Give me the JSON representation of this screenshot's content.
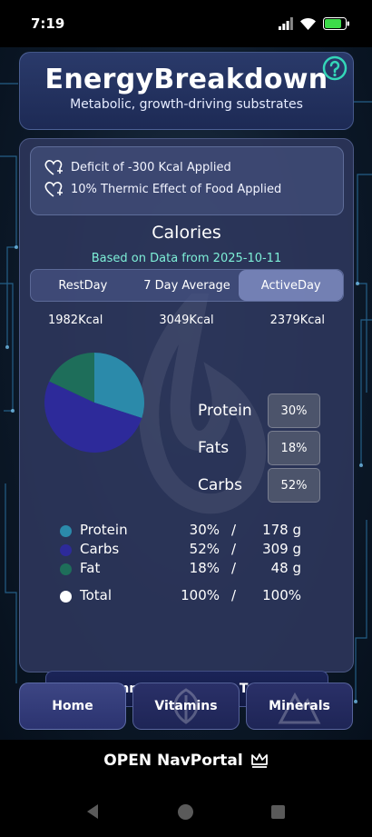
{
  "status": {
    "time": "7:19"
  },
  "header": {
    "title": "EnergyBreakdown",
    "subtitle": "Metabolic, growth-driving substrates",
    "help_icon": "help-circle-icon"
  },
  "notes": [
    {
      "icon": "heart-plus-icon",
      "text": "Deficit of -300 Kcal Applied"
    },
    {
      "icon": "heart-plus-icon",
      "text": "10% Thermic Effect of Food Applied"
    }
  ],
  "calories": {
    "title": "Calories",
    "data_date": "Based on Data from 2025-10-11",
    "tabs": [
      {
        "label": "RestDay",
        "active": false
      },
      {
        "label": "7 Day Average",
        "active": false
      },
      {
        "label": "ActiveDay",
        "active": true
      }
    ],
    "kcal_values": [
      "1982Kcal",
      "3049Kcal",
      "2379Kcal"
    ]
  },
  "macro_pills": [
    {
      "label": "Protein",
      "value": "30%"
    },
    {
      "label": "Fats",
      "value": "18%"
    },
    {
      "label": "Carbs",
      "value": "52%"
    }
  ],
  "chart_data": {
    "type": "pie",
    "slices": [
      {
        "name": "Protein",
        "value": 30,
        "color": "#2b8aaa"
      },
      {
        "name": "Carbs",
        "value": 52,
        "color": "#2d2a9a"
      },
      {
        "name": "Fat",
        "value": 18,
        "color": "#1e6e5a"
      }
    ]
  },
  "legend": [
    {
      "name": "Protein",
      "percent": "30%",
      "slash": "/",
      "grams": "178 g",
      "color": "#2b8aaa"
    },
    {
      "name": "Carbs",
      "percent": "52%",
      "slash": "/",
      "grams": "309 g",
      "color": "#2d2a9a"
    },
    {
      "name": "Fat",
      "percent": "18%",
      "slash": "/",
      "grams": "48 g",
      "color": "#1e6e5a"
    }
  ],
  "total": {
    "name": "Total",
    "percent": "100%",
    "slash": "/",
    "value": "100%",
    "color": "#ffffff"
  },
  "targets_button": "Recommended Macro Targets",
  "nav": [
    {
      "label": "Home",
      "active": true
    },
    {
      "label": "Vitamins",
      "active": false
    },
    {
      "label": "Minerals",
      "active": false
    }
  ],
  "portal": {
    "label": "OPEN NavPortal",
    "icon": "crown-icon"
  },
  "system_nav": [
    "back-icon",
    "home-icon",
    "recents-icon"
  ]
}
